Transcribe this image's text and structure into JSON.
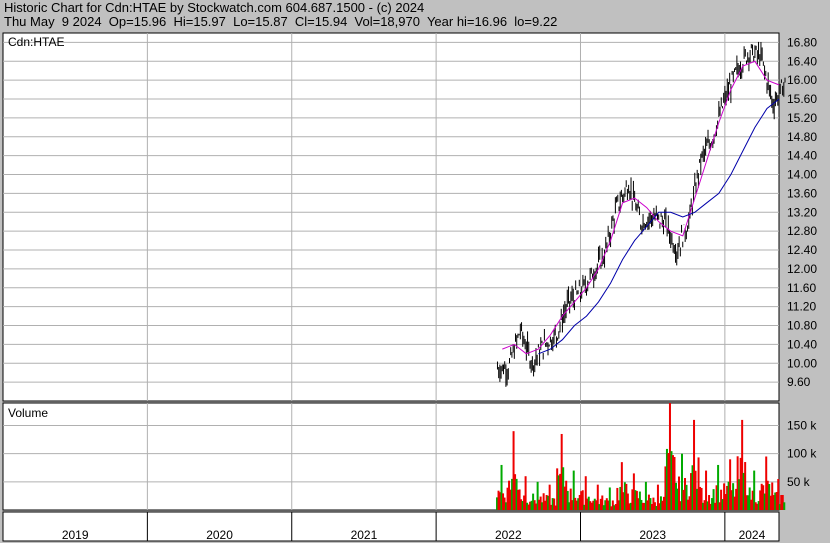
{
  "header": {
    "line1": "Historic Chart for Cdn:HTAE by Stockwatch.com 604.687.1500 - (c) 2024",
    "line2": "Thu May  9 2024  Op=15.96  Hi=15.97  Lo=15.87  Cl=15.94  Vol=18,970  Year hi=16.96  lo=9.22"
  },
  "colors": {
    "background": "#c0c0c0",
    "plot": "#ffffff",
    "price_bars": "#000000",
    "ma_short": "#cc00cc",
    "ma_long": "#0000aa",
    "volume_up": "#00aa00",
    "volume_down": "#ee0000",
    "grid": "#b0b0b0"
  },
  "chart_data": [
    {
      "type": "line",
      "title": "Cdn:HTAE",
      "xlabel": "",
      "ylabel": "",
      "ylim": [
        9.2,
        17.0
      ],
      "yticks": [
        "16.80",
        "16.40",
        "16.00",
        "15.60",
        "15.20",
        "14.80",
        "14.40",
        "14.00",
        "13.60",
        "13.20",
        "12.80",
        "12.40",
        "12.00",
        "11.60",
        "11.20",
        "10.80",
        "10.40",
        "10.00",
        "9.60"
      ],
      "x_labels": [
        "2019",
        "2020",
        "2021",
        "2022",
        "2023",
        "2024"
      ],
      "x": [
        "2022-06",
        "2022-07",
        "2022-08",
        "2022-09",
        "2022-10",
        "2022-11",
        "2022-12",
        "2023-01",
        "2023-02",
        "2023-03",
        "2023-04",
        "2023-05",
        "2023-06",
        "2023-07",
        "2023-08",
        "2023-09",
        "2023-10",
        "2023-11",
        "2023-12",
        "2024-01",
        "2024-02",
        "2024-03",
        "2024-04",
        "2024-05"
      ],
      "series": [
        {
          "values": [
            9.9,
            10.7,
            10.0,
            10.4,
            10.6,
            11.3,
            11.5,
            11.9,
            12.3,
            13.3,
            13.8,
            13.0,
            13.1,
            13.0,
            12.4,
            13.0,
            14.3,
            14.8,
            15.6,
            16.2,
            16.6,
            16.5,
            15.5,
            15.94
          ]
        },
        {
          "values": [
            10.3,
            10.4,
            10.2,
            10.3,
            10.6,
            11.0,
            11.3,
            11.6,
            12.0,
            12.6,
            13.4,
            13.5,
            13.3,
            13.0,
            12.8,
            12.7,
            13.5,
            14.3,
            15.1,
            15.8,
            16.3,
            16.4,
            16.0,
            15.9
          ]
        },
        {
          "values": [
            null,
            null,
            null,
            10.2,
            10.3,
            10.5,
            10.8,
            11.0,
            11.3,
            11.7,
            12.2,
            12.6,
            12.9,
            13.2,
            13.2,
            13.1,
            13.2,
            13.4,
            13.6,
            14.0,
            14.5,
            15.0,
            15.4,
            15.6
          ]
        }
      ],
      "grid": true
    },
    {
      "type": "bar",
      "title": "Volume",
      "ylim": [
        0,
        190000
      ],
      "yticks": [
        "150 k",
        "100 k",
        "50 k"
      ],
      "categories": [
        "2022-06",
        "2022-07",
        "2022-08",
        "2022-09",
        "2022-10",
        "2022-11",
        "2022-12",
        "2023-01",
        "2023-02",
        "2023-03",
        "2023-04",
        "2023-05",
        "2023-06",
        "2023-07",
        "2023-08",
        "2023-09",
        "2023-10",
        "2023-11",
        "2023-12",
        "2024-01",
        "2024-02",
        "2024-03",
        "2024-04",
        "2024-05"
      ],
      "values": [
        80000,
        140000,
        60000,
        50000,
        45000,
        135000,
        70000,
        60000,
        45000,
        40000,
        85000,
        65000,
        50000,
        45000,
        190000,
        100000,
        160000,
        70000,
        80000,
        90000,
        160000,
        70000,
        95000,
        55000
      ],
      "grid": true
    }
  ]
}
